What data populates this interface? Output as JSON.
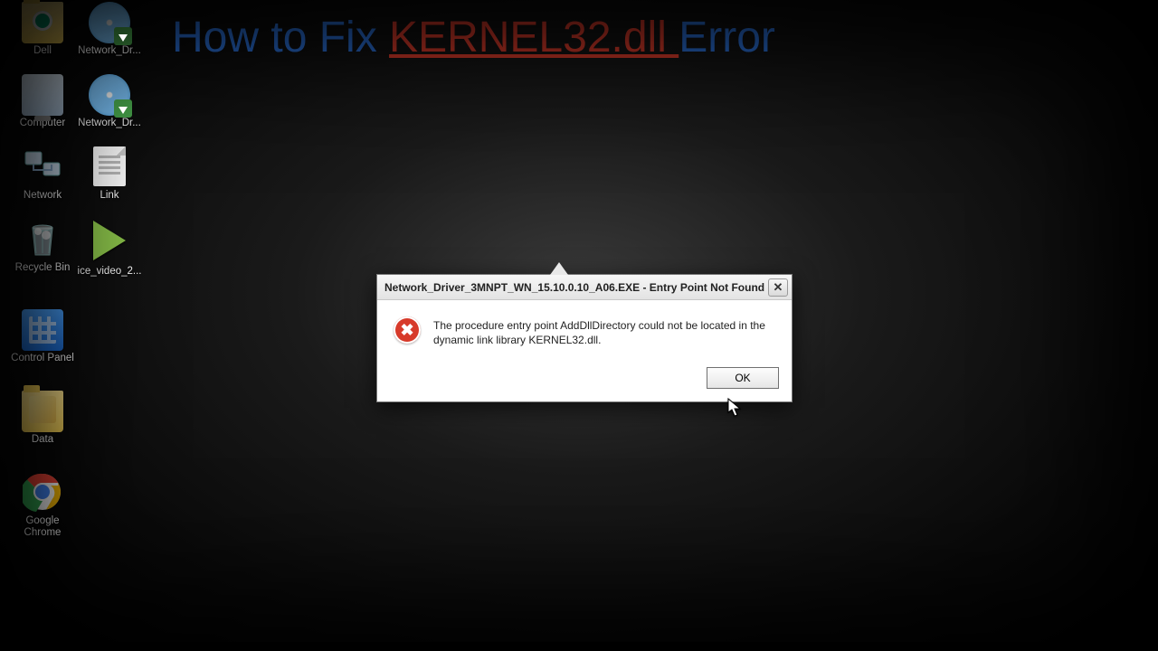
{
  "desktop": {
    "icons": [
      {
        "label": "Dell"
      },
      {
        "label": "Network_Dr..."
      },
      {
        "label": "Computer"
      },
      {
        "label": "Network_Dr..."
      },
      {
        "label": "Network"
      },
      {
        "label": "Link"
      },
      {
        "label": "Recycle Bin"
      },
      {
        "label": "ice_video_2..."
      },
      {
        "label": "Control Panel"
      },
      {
        "label": "Data"
      },
      {
        "label": "Google Chrome"
      }
    ]
  },
  "title": {
    "part1": "How to Fix ",
    "highlight": "KERNEL32.dll ",
    "part2": "Error"
  },
  "dialog": {
    "title": "Network_Driver_3MNPT_WN_15.10.0.10_A06.EXE - Entry Point Not Found",
    "message": "The procedure entry point AddDllDirectory could not be located in the dynamic link library KERNEL32.dll.",
    "ok_label": "OK",
    "close_glyph": "✕"
  }
}
